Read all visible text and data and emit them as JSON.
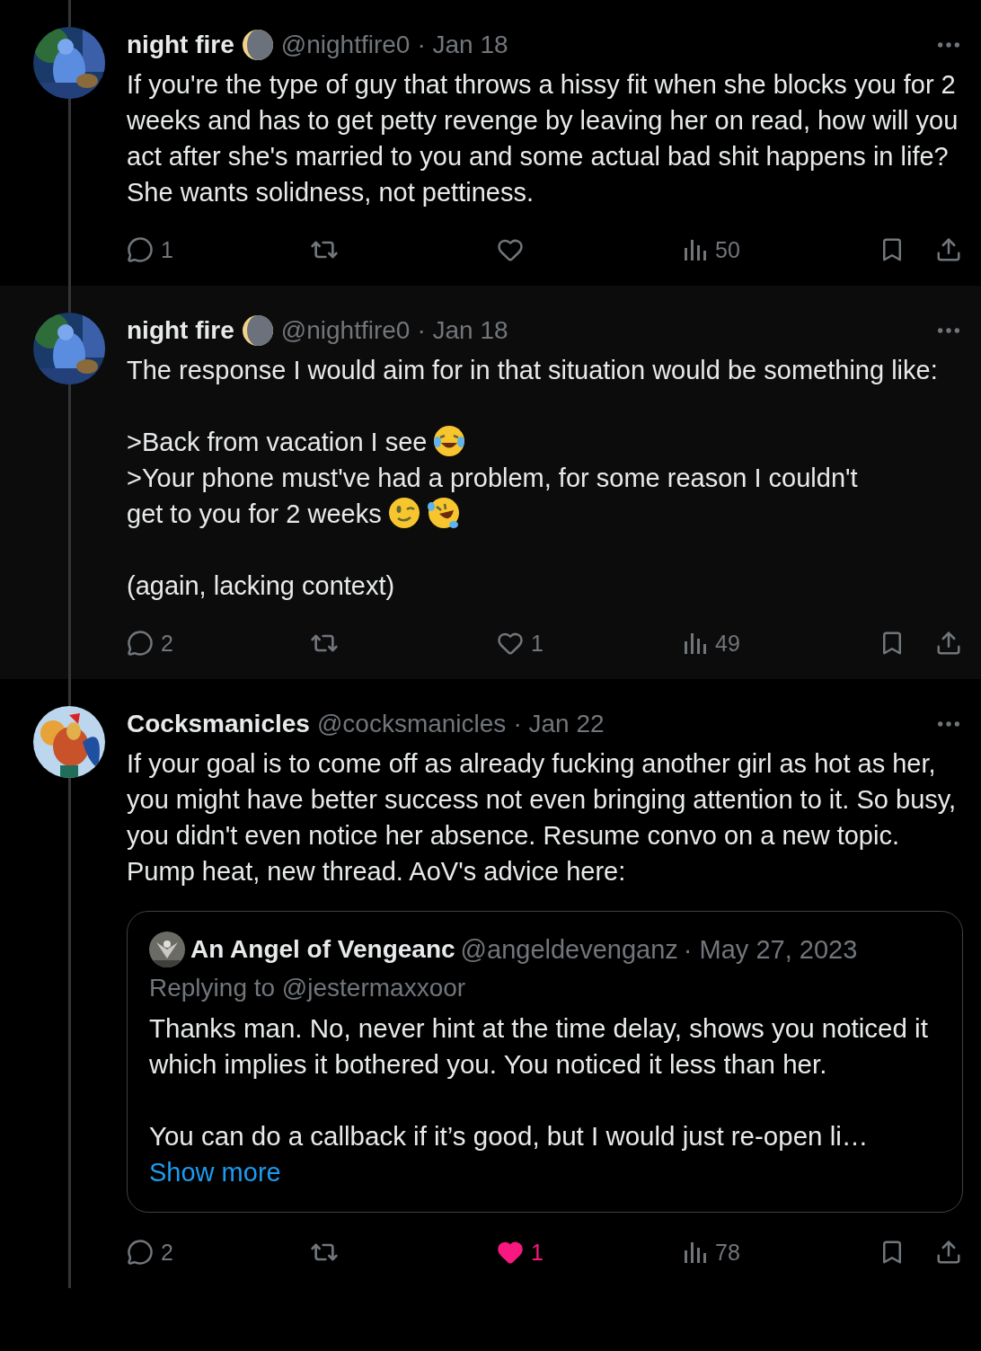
{
  "tweets": [
    {
      "name": "night fire",
      "badge": true,
      "handle": "@nightfire0",
      "date": "· Jan 18",
      "highlighted": false,
      "paragraphs": [
        {
          "lines": [
            {
              "text": "If you're the type of guy that throws a hissy fit when she blocks you for 2 weeks and has to get petty revenge by leaving her on read, how will you act after she's married to you and some actual bad shit happens in life? She wants solidness, not pettiness."
            }
          ]
        }
      ],
      "actions": {
        "replies": "1",
        "views": "50",
        "liked": false
      }
    },
    {
      "name": "night fire",
      "badge": true,
      "handle": "@nightfire0",
      "date": "· Jan 18",
      "highlighted": true,
      "paragraphs": [
        {
          "lines": [
            {
              "text": "The response I would aim for in that situation would be something like:"
            }
          ]
        },
        {
          "lines": [
            {
              "text": ">Back from vacation I see",
              "icons": [
                {
                  "kind": "tearsofjoy"
                }
              ]
            },
            {
              "text": ">Your phone must've had a problem, for some reason I couldn't"
            },
            {
              "text": "get to you for 2 weeks",
              "icons": [
                {
                  "kind": "wink"
                },
                {
                  "kind": "rofl"
                }
              ]
            }
          ]
        },
        {
          "lines": [
            {
              "text": "(again, lacking context)"
            }
          ]
        }
      ],
      "actions": {
        "replies": "2",
        "likes": "1",
        "views": "49",
        "liked": false
      }
    },
    {
      "name": "Cocksmanicles",
      "badge": false,
      "handle": "@cocksmanicles",
      "date": "· Jan 22",
      "highlighted": false,
      "paragraphs": [
        {
          "lines": [
            {
              "text": "If your goal is to come off as already fucking another girl as hot as her, you might have better success not even bringing attention to it. So busy, you didn't even notice her absence. Resume convo on a new topic. Pump heat, new thread. AoV's advice here:"
            }
          ]
        }
      ],
      "quote": {
        "name": "An Angel of Vengeanc",
        "handle": "@angeldevenganz",
        "date": "· May 27, 2023",
        "replying": "Replying to @jestermaxxoor",
        "paragraphs": [
          "Thanks man. No, never hint at the time delay, shows you noticed it which implies it bothered you. You noticed it less than her.",
          "You can do a callback if it’s good, but I would just re-open li…"
        ],
        "show_more": "Show more"
      },
      "actions": {
        "replies": "2",
        "likes": "1",
        "views": "78",
        "liked": true
      }
    }
  ]
}
